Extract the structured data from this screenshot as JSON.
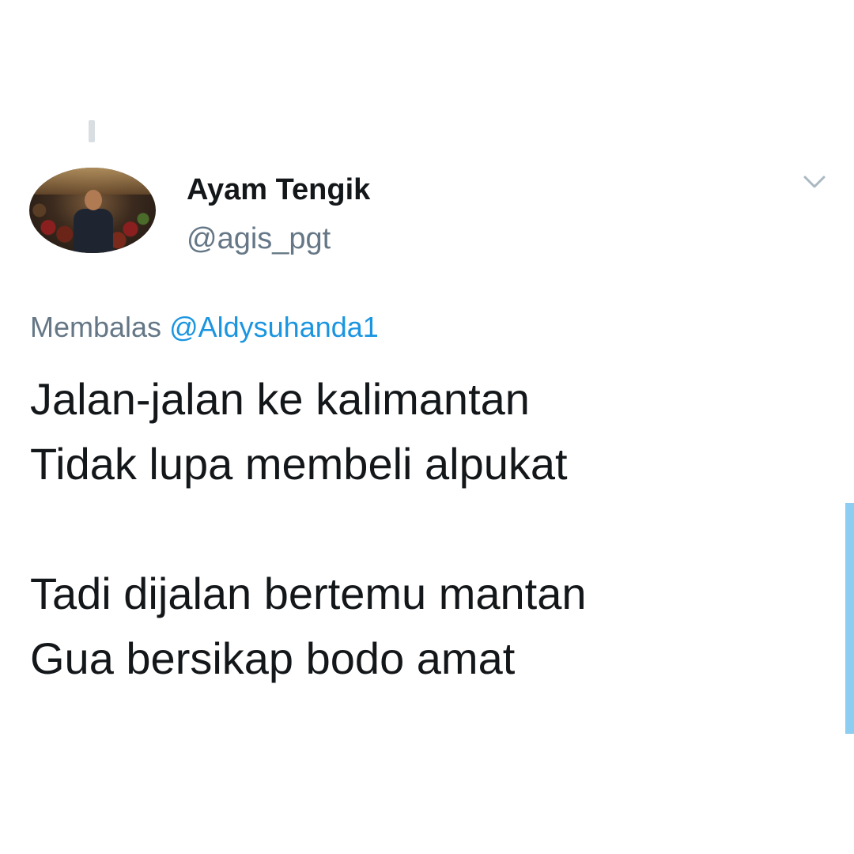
{
  "tweet": {
    "author": {
      "display_name": "Ayam Tengik",
      "handle": "@agis_pgt"
    },
    "reply_prefix": "Membalas",
    "reply_to": "@Aldysuhanda1",
    "lines": [
      "Jalan-jalan ke kalimantan",
      "Tidak lupa membeli alpukat",
      "",
      "Tadi dijalan bertemu mantan",
      "Gua bersikap bodo amat"
    ]
  },
  "icons": {
    "menu": "chevron-down-icon",
    "avatar": "avatar"
  },
  "colors": {
    "text_primary": "#14171a",
    "text_secondary": "#657786",
    "link": "#1b95e0",
    "scroll_indicator": "#8ecdf2"
  }
}
